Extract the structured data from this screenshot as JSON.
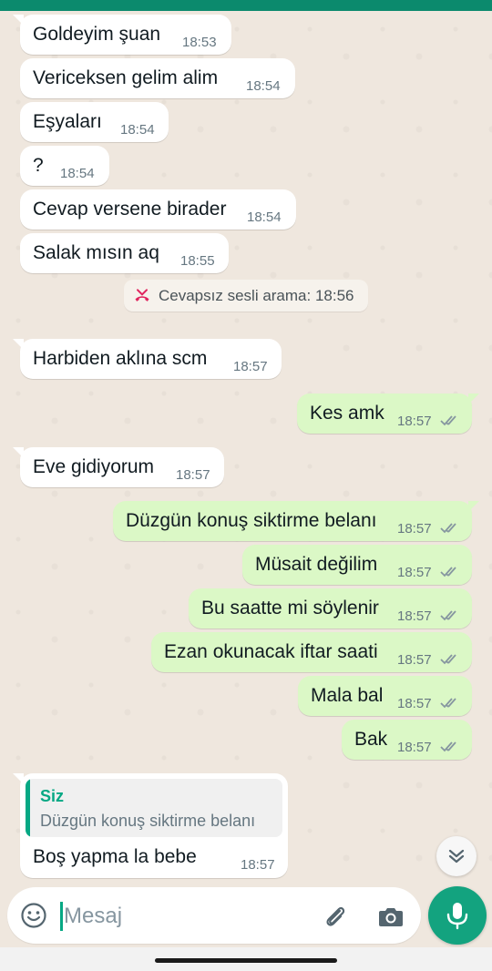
{
  "messages": [
    {
      "dir": "in",
      "text": "Goldeyim şuan",
      "time": "18:53"
    },
    {
      "dir": "in",
      "text": "Vericeksen gelim alim",
      "time": "18:54"
    },
    {
      "dir": "in",
      "text": "Eşyaları",
      "time": "18:54"
    },
    {
      "dir": "in",
      "text": "?",
      "time": "18:54"
    },
    {
      "dir": "in",
      "text": "Cevap versene birader",
      "time": "18:54"
    },
    {
      "dir": "in",
      "text": "Salak mısın aq",
      "time": "18:55"
    },
    {
      "dir": "in",
      "text": "Harbiden aklına scm",
      "time": "18:57"
    },
    {
      "dir": "out",
      "text": "Kes amk",
      "time": "18:57"
    },
    {
      "dir": "in",
      "text": "Eve gidiyorum",
      "time": "18:57"
    },
    {
      "dir": "out",
      "text": "Düzgün konuş siktirme belanı",
      "time": "18:57"
    },
    {
      "dir": "out",
      "text": "Müsait değilim",
      "time": "18:57"
    },
    {
      "dir": "out",
      "text": "Bu saatte mi söylenir",
      "time": "18:57"
    },
    {
      "dir": "out",
      "text": "Ezan okunacak iftar saati",
      "time": "18:57"
    },
    {
      "dir": "out",
      "text": "Mala bal",
      "time": "18:57"
    },
    {
      "dir": "out",
      "text": "Bak",
      "time": "18:57"
    }
  ],
  "system_note": {
    "text": "Cevapsız sesli arama: 18:56",
    "icon": "missed-call-icon"
  },
  "reply": {
    "quote_author": "Siz",
    "quote_text": "Düzgün konuş siktirme belanı",
    "text": "Boş yapma la bebe",
    "time": "18:57"
  },
  "input": {
    "placeholder": "Mesaj",
    "value": ""
  },
  "colors": {
    "accent": "#13a37f",
    "header": "#0b8a6d",
    "outgoing_bubble": "#dbf8c6",
    "incoming_bubble": "#ffffff",
    "read_ticks": "#8696a0",
    "missed_call": "#e0245e"
  },
  "icons": {
    "emoji": "emoji-icon",
    "attach": "paperclip-icon",
    "camera": "camera-icon",
    "mic": "microphone-icon",
    "scroll": "double-chevron-down-icon"
  }
}
